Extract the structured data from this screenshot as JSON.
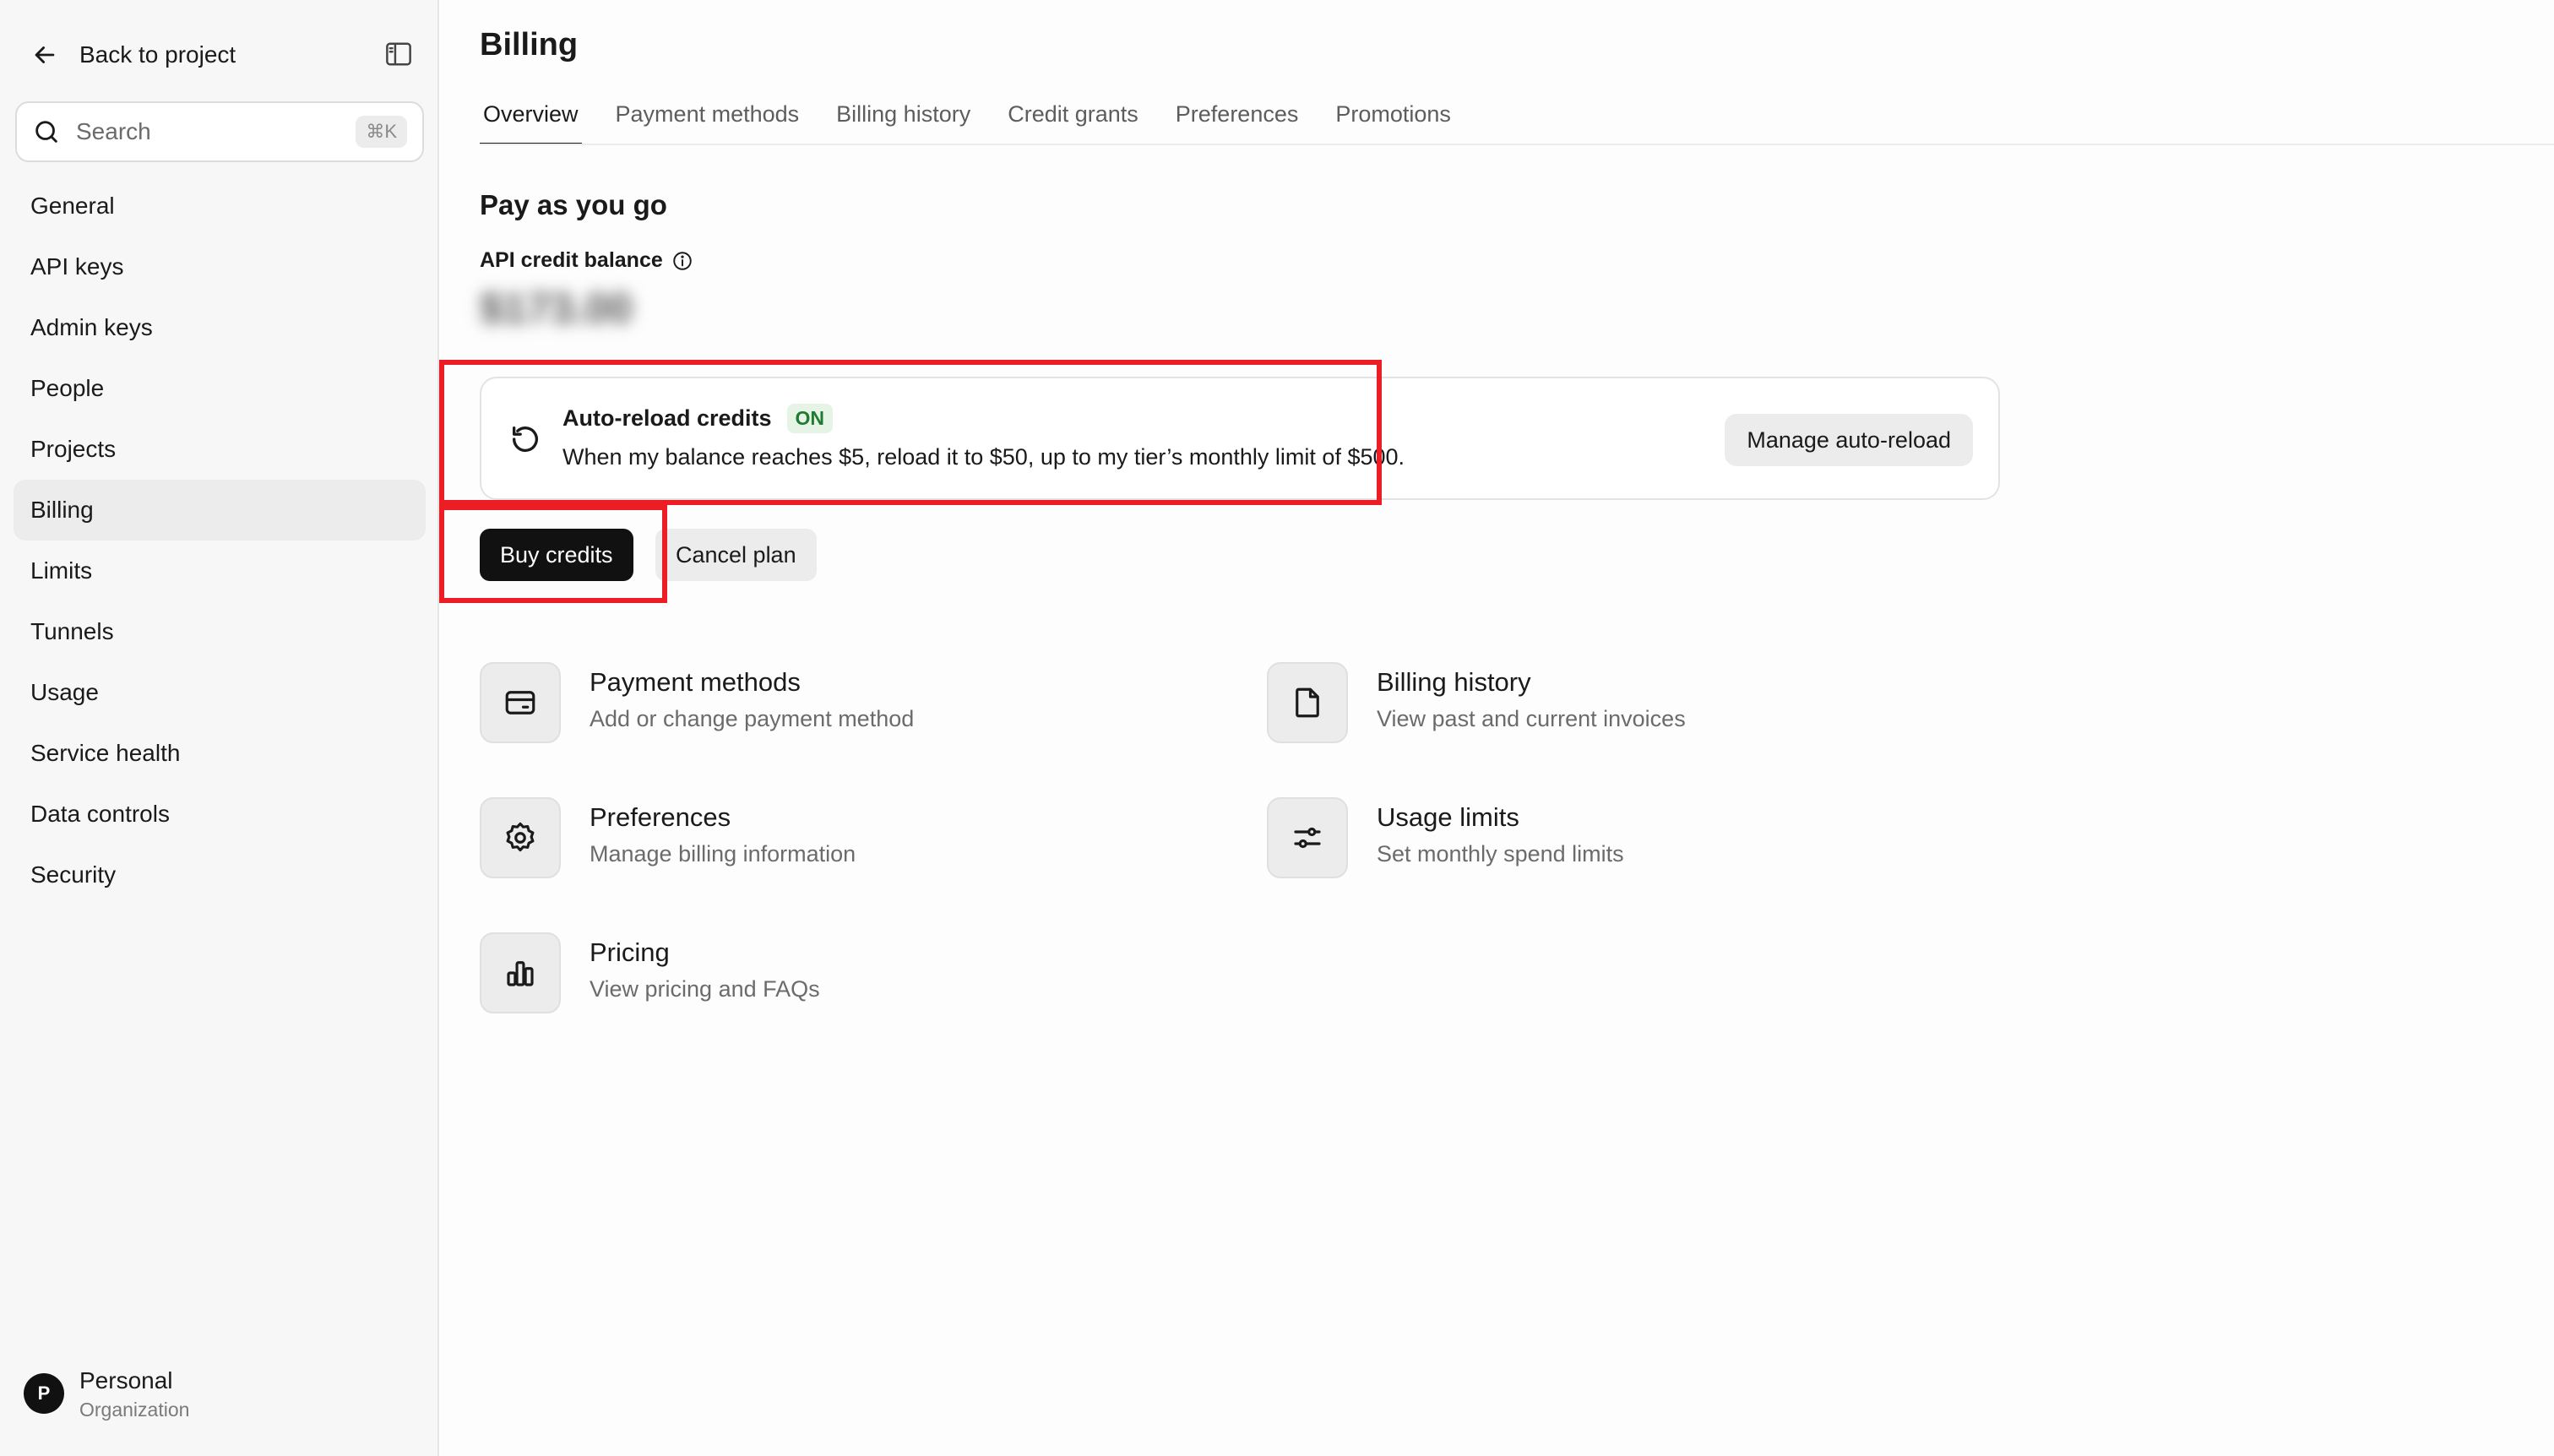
{
  "sidebar": {
    "back_label": "Back to project",
    "search": {
      "placeholder": "Search",
      "shortcut": "⌘K"
    },
    "items": [
      {
        "label": "General",
        "active": false
      },
      {
        "label": "API keys",
        "active": false
      },
      {
        "label": "Admin keys",
        "active": false
      },
      {
        "label": "People",
        "active": false
      },
      {
        "label": "Projects",
        "active": false
      },
      {
        "label": "Billing",
        "active": true
      },
      {
        "label": "Limits",
        "active": false
      },
      {
        "label": "Tunnels",
        "active": false
      },
      {
        "label": "Usage",
        "active": false
      },
      {
        "label": "Service health",
        "active": false
      },
      {
        "label": "Data controls",
        "active": false
      },
      {
        "label": "Security",
        "active": false
      }
    ],
    "org": {
      "initial": "P",
      "name": "Personal",
      "type": "Organization"
    }
  },
  "page": {
    "title": "Billing",
    "tabs": [
      {
        "label": "Overview",
        "active": true
      },
      {
        "label": "Payment methods",
        "active": false
      },
      {
        "label": "Billing history",
        "active": false
      },
      {
        "label": "Credit grants",
        "active": false
      },
      {
        "label": "Preferences",
        "active": false
      },
      {
        "label": "Promotions",
        "active": false
      }
    ],
    "section_title": "Pay as you go",
    "balance_label": "API credit balance",
    "balance_value": "$173.00",
    "auto_reload": {
      "title": "Auto-reload credits",
      "status": "ON",
      "description": "When my balance reaches $5, reload it to $50, up to my tier’s monthly limit of $500.",
      "manage_label": "Manage auto-reload"
    },
    "buy_label": "Buy credits",
    "cancel_label": "Cancel plan",
    "links": [
      {
        "title": "Payment methods",
        "desc": "Add or change payment method",
        "icon": "credit-card-icon"
      },
      {
        "title": "Billing history",
        "desc": "View past and current invoices",
        "icon": "document-icon"
      },
      {
        "title": "Preferences",
        "desc": "Manage billing information",
        "icon": "gear-icon"
      },
      {
        "title": "Usage limits",
        "desc": "Set monthly spend limits",
        "icon": "sliders-icon"
      },
      {
        "title": "Pricing",
        "desc": "View pricing and FAQs",
        "icon": "bar-chart-icon"
      }
    ]
  },
  "colors": {
    "highlight": "#ec1d24",
    "primary_button": "#111111",
    "badge_green": "#1f7a33"
  }
}
